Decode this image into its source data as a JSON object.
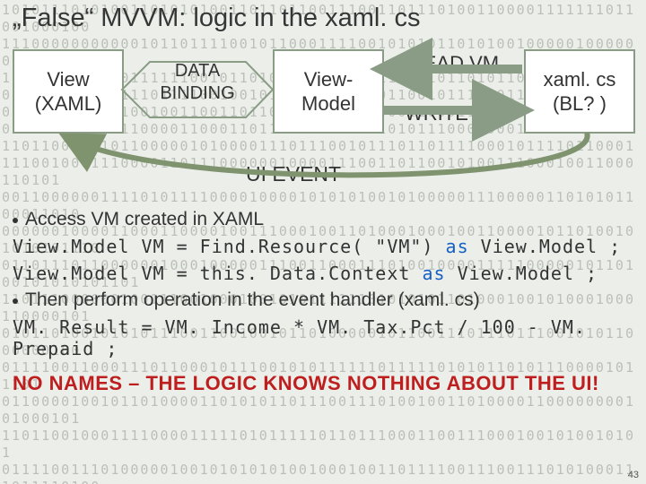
{
  "title": "„False“ MVVM: logic in the xaml. cs",
  "diagram": {
    "view": "View\n(XAML)",
    "binding": "DATA\nBINDING",
    "vm": "View-\nModel",
    "read": "READ VM",
    "write": "WRITE VM",
    "bl": "xaml. cs\n(BL? )",
    "uievent": "UI EVENT"
  },
  "bullets": {
    "b1": "Access VM created in XAML",
    "b2": "Then perform operation in the event handler  (xaml. cs)"
  },
  "code": {
    "c1a": "View.Model VM = Find.Resource( \"VM\") ",
    "c1b": " View.Model ;",
    "c2a": "View.Model VM = this. Data.Context  ",
    "c2b": " View.Model ;",
    "kw": "as",
    "op": "VM. Result = VM. Income * VM. Tax.Pct / 100 - VM. Prepaid  ;"
  },
  "warn": "NO NAMES – THE LOGIC KNOWS NOTHING ABOUT THE UI!",
  "bgbits": "1010111010100110101010011011011001110011011101001100001111111011001000100\n1110000000000010110111100101100011110010101011010100100000100000001\n1100101011000111111001011010011000100011010101101011000010101011\n0010101110001110111100100101000101101001100101110101110001\n011000001010100100110011011010011011010001100011001001100110100\n0111111100001100001100011011100101001110101110001000110100100\n1101100011101100000101000011101110010111011011110001011110110001\n1110010001110000110111000000100001110011011001010011100010011000110101\n001100000011110101111000010000101010100101000001110000011010101100011010\n00000010000110001100001001110001001101000100010011000010110100101010101110\n011011101100000010001000001110011000111010010000111110000010110100101010101101\n1101110000001001110010001001010111111010101011010001001010001000110000101\n010110100101010111001100100101101000001011001110111011100101011000000100\n01111001100011101100010111001010111111011111010101101011100001011101\n011000010010110100001101010110111001110100100110100001100000000101000101\n11011001000111100001111101011111011011100011001110001001010010101\n01111001110100000100101010101001000100110111100111001110101000111011110100\n000010110111110111011101111010111011000111011001001011110010010010101010\n1011101101001110010000001100001011010101100110100110001011101000001100101",
  "page": "43"
}
